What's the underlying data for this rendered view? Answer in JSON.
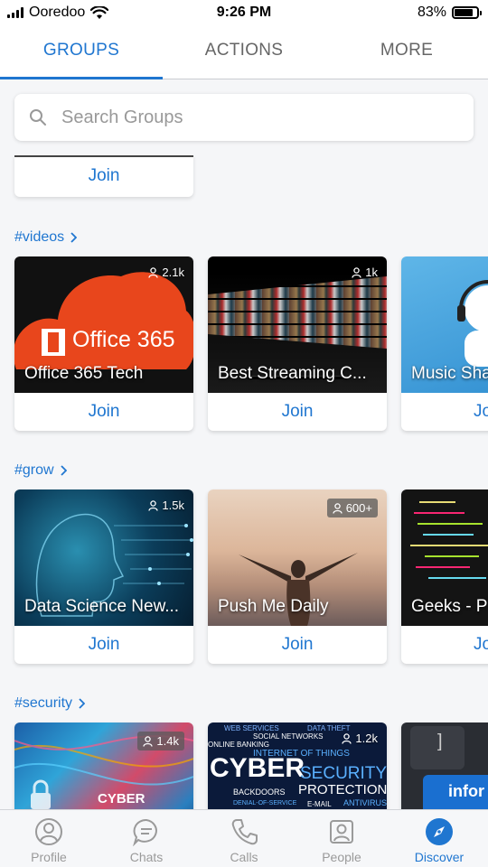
{
  "status_bar": {
    "carrier": "Ooredoo",
    "time": "9:26 PM",
    "battery": "83%",
    "battery_level": 0.83
  },
  "top_tabs": [
    {
      "label": "GROUPS",
      "active": true
    },
    {
      "label": "ACTIONS",
      "active": false
    },
    {
      "label": "MORE",
      "active": false
    }
  ],
  "search": {
    "placeholder": "Search Groups",
    "value": ""
  },
  "join_label": "Join",
  "sections": [
    {
      "title": "#videos",
      "cards": [
        {
          "name": "Office 365 Tech",
          "members": "2.1k",
          "logo_text": "Office 365"
        },
        {
          "name": "Best Streaming C...",
          "members": "1k"
        },
        {
          "name": "Music Sha",
          "members": ""
        }
      ]
    },
    {
      "title": "#grow",
      "cards": [
        {
          "name": "Data Science New...",
          "members": "1.5k"
        },
        {
          "name": "Push Me Daily",
          "members": "600+"
        },
        {
          "name": "Geeks - P",
          "members": ""
        }
      ]
    },
    {
      "title": "#security",
      "cards": [
        {
          "name": "CYBER",
          "members": "1.4k"
        },
        {
          "name": "CYBER SECURITY",
          "members": "1.2k",
          "words": [
            "WEB SERVICES",
            "DATA THEFT",
            "SOCIAL NETWORKS",
            "ONLINE BANKING",
            "INTERNET OF THINGS",
            "CYBER",
            "SECURITY",
            "BACKDOORS",
            "PROTECTION",
            "DENIAL-OF-SERVICE",
            "E-MAIL",
            "ANTIVIRUS"
          ]
        },
        {
          "name": "",
          "members": "",
          "key_text": "infor"
        }
      ]
    }
  ],
  "bottom_nav": [
    {
      "label": "Profile",
      "icon": "profile-icon",
      "active": false
    },
    {
      "label": "Chats",
      "icon": "chats-icon",
      "active": false
    },
    {
      "label": "Calls",
      "icon": "calls-icon",
      "active": false
    },
    {
      "label": "People",
      "icon": "people-icon",
      "active": false
    },
    {
      "label": "Discover",
      "icon": "compass-icon",
      "active": true
    }
  ],
  "colors": {
    "accent": "#1f76d0",
    "inactive": "#9a9a9a",
    "office_orange": "#e8461c"
  }
}
